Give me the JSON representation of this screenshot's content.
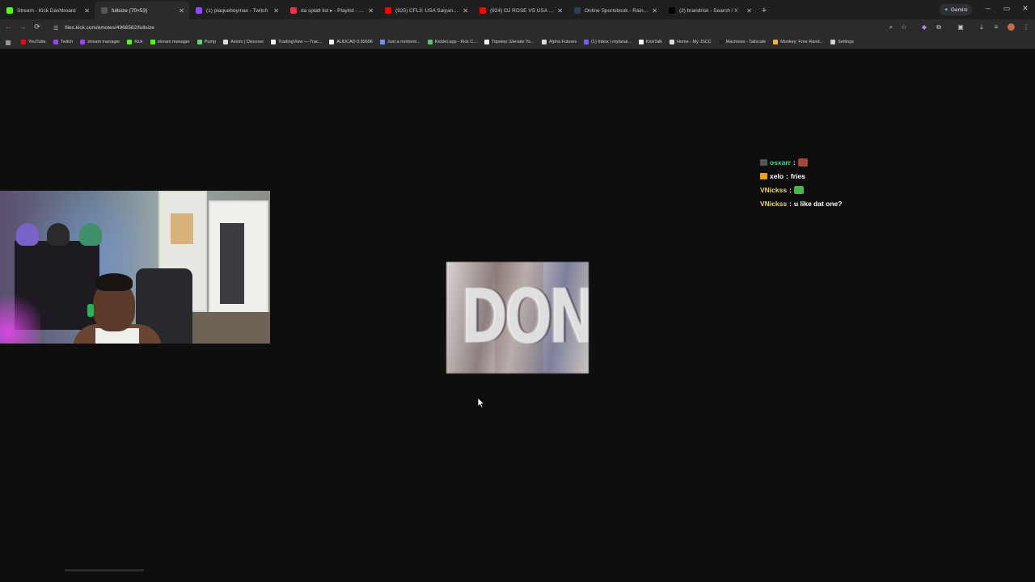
{
  "tabs": [
    {
      "title": "Stream - Kick Dashboard",
      "fav": "#53fc18",
      "active": false
    },
    {
      "title": "fullsize (70×53)",
      "fav": "#555555",
      "active": true
    },
    {
      "title": "(1) plaqueboymax - Twitch",
      "fav": "#9146ff",
      "active": false
    },
    {
      "title": "da splatt list ▸ - Playlist - App",
      "fav": "#fa2d48",
      "active": false
    },
    {
      "title": "(925) CFL3: USA Saiyan vs. Arch",
      "fav": "#ff0000",
      "active": false
    },
    {
      "title": "(924) OJ ROSÉ VS USA SAIYAN",
      "fav": "#ff0000",
      "active": false
    },
    {
      "title": "Online Sportsbook - Rainbet",
      "fav": "#2f3a57",
      "active": false
    },
    {
      "title": "(2) brandrisk - Search / X",
      "fav": "#000000",
      "active": false
    }
  ],
  "newtab_icon": "+",
  "gemini_label": "Gemini",
  "window_controls": [
    "–",
    "▭",
    "✕"
  ],
  "toolbar": {
    "back_icon": "←",
    "forward_icon": "→",
    "reload_icon": "⟳",
    "url": "files.kick.com/emotes/4966562/fullsize"
  },
  "bookmarks": [
    {
      "label": "YouTube",
      "color": "#ff0000"
    },
    {
      "label": "Twitch",
      "color": "#9146ff"
    },
    {
      "label": "stream manager",
      "color": "#9146ff"
    },
    {
      "label": "Kick",
      "color": "#53fc18"
    },
    {
      "label": "stream manager",
      "color": "#53fc18"
    },
    {
      "label": "Pump",
      "color": "#6ad07b"
    },
    {
      "label": "Axiom | Discover",
      "color": "#dddddd"
    },
    {
      "label": "TradingView — Trac...",
      "color": "#ffffff"
    },
    {
      "label": "AUDCAD 0.89596",
      "color": "#ffffff"
    },
    {
      "label": "Just a moment...",
      "color": "#7b8cff"
    },
    {
      "label": "Kicklet.app - Kick C...",
      "color": "#5ec36d"
    },
    {
      "label": "Topstep: Elevate Yo...",
      "color": "#ffffff"
    },
    {
      "label": "Alpha Futures",
      "color": "#dddddd"
    },
    {
      "label": "(1) Inbox | mylanai...",
      "color": "#7b5cff"
    },
    {
      "label": "KickTalk",
      "color": "#ffffff"
    },
    {
      "label": "Home - My JSCC",
      "color": "#dddddd"
    },
    {
      "label": "Machines - Tailscale",
      "color": "#222222"
    },
    {
      "label": "Monkey: Free Rand...",
      "color": "#f4b03a"
    },
    {
      "label": "Settings",
      "color": "#cfcfcf"
    }
  ],
  "emote_text": "DONK",
  "chat": [
    {
      "user": "osxarr",
      "user_color": "#3ddc84",
      "badge_color": "#555555",
      "message": "",
      "emote_color": "#a0473b"
    },
    {
      "user": "xelo",
      "user_color": "#ffffff",
      "badge_color": "#e8a317",
      "message": "fries",
      "emote_color": ""
    },
    {
      "user": "VNickss",
      "user_color": "#f2d36b",
      "badge_color": "",
      "message": "",
      "emote_color": "#45b649"
    },
    {
      "user": "VNickss",
      "user_color": "#f2d36b",
      "badge_color": "",
      "message": "u like dat one?",
      "emote_color": ""
    }
  ]
}
